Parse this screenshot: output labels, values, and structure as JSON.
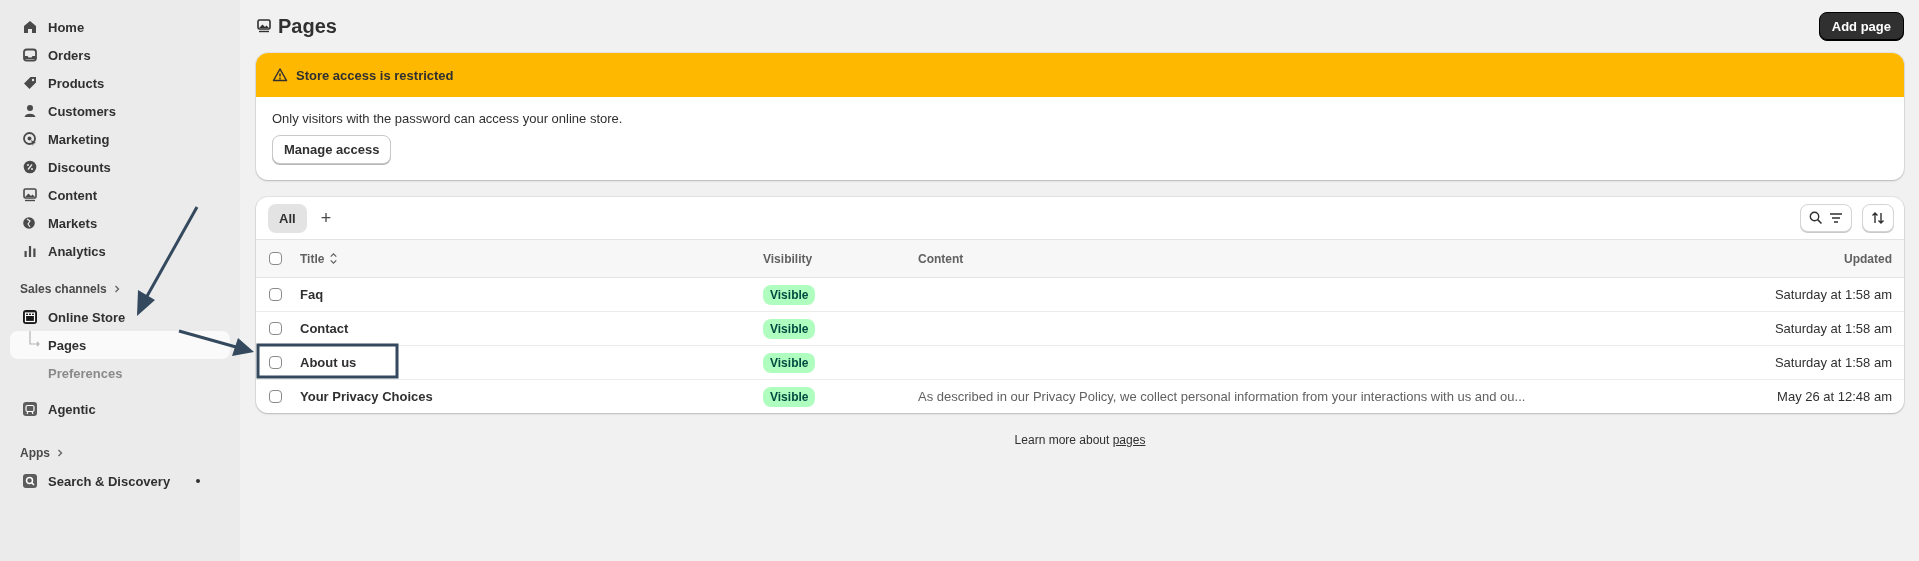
{
  "sidebar": {
    "items": [
      {
        "label": "Home",
        "selected": false
      },
      {
        "label": "Orders",
        "selected": false
      },
      {
        "label": "Products",
        "selected": false
      },
      {
        "label": "Customers",
        "selected": false
      },
      {
        "label": "Marketing",
        "selected": false
      },
      {
        "label": "Discounts",
        "selected": false
      },
      {
        "label": "Content",
        "selected": false
      },
      {
        "label": "Markets",
        "selected": false
      },
      {
        "label": "Analytics",
        "selected": false
      }
    ],
    "sales_channels": {
      "label": "Sales channels",
      "items": [
        {
          "label": "Online Store",
          "selected": false,
          "children": [
            {
              "label": "Pages",
              "selected": true
            },
            {
              "label": "Preferences",
              "selected": false
            }
          ]
        },
        {
          "label": "Agentic",
          "selected": false
        }
      ]
    },
    "apps": {
      "label": "Apps",
      "items": [
        {
          "label": "Search & Discovery",
          "selected": false,
          "pinned": true
        }
      ]
    }
  },
  "page": {
    "title": "Pages",
    "add_button": "Add page"
  },
  "banner": {
    "title": "Store access is restricted",
    "message": "Only visitors with the password can access your online store.",
    "button": "Manage access"
  },
  "table": {
    "tabs": [
      {
        "label": "All",
        "selected": true
      }
    ],
    "add_tab": "+",
    "select_all": {
      "checked": false
    },
    "columns": [
      "Title",
      "Visibility",
      "Content",
      "Updated"
    ],
    "rows": [
      {
        "title": "Faq",
        "visibility": "Visible",
        "content": "",
        "updated": "Saturday at 1:58 am",
        "checked": false
      },
      {
        "title": "Contact",
        "visibility": "Visible",
        "content": "",
        "updated": "Saturday at 1:58 am",
        "checked": false
      },
      {
        "title": "About us",
        "visibility": "Visible",
        "content": "",
        "updated": "Saturday at 1:58 am",
        "checked": false
      },
      {
        "title": "Your Privacy Choices",
        "visibility": "Visible",
        "content": "As described in our Privacy Policy, we collect personal information from your interactions with us and ou...",
        "updated": "May 26 at 12:48 am",
        "checked": false
      }
    ]
  },
  "footer": {
    "text": "Learn more about",
    "link": "pages"
  }
}
